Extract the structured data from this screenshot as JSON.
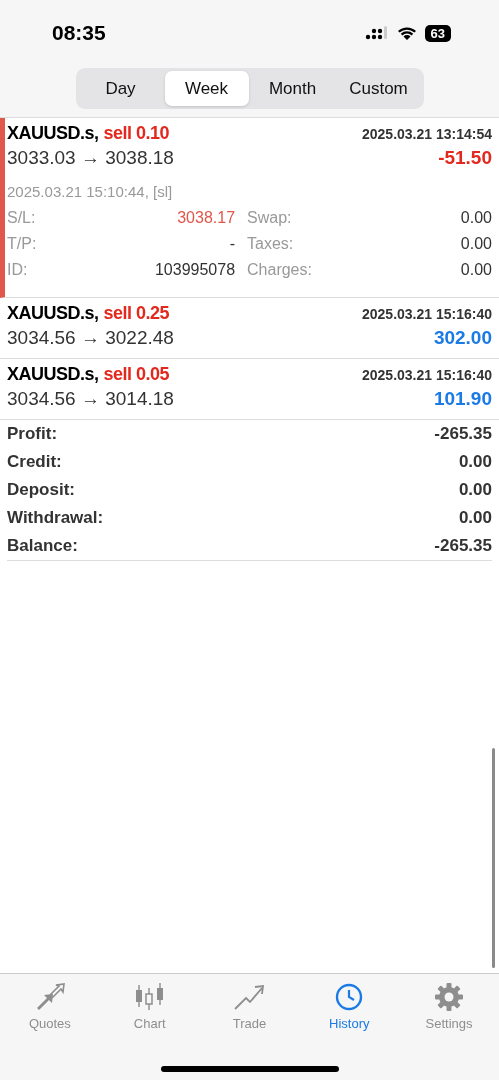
{
  "status_bar": {
    "time": "08:35",
    "battery": "63"
  },
  "periods": [
    {
      "label": "Day",
      "selected": false
    },
    {
      "label": "Week",
      "selected": true
    },
    {
      "label": "Month",
      "selected": false
    },
    {
      "label": "Custom",
      "selected": false
    }
  ],
  "deals": [
    {
      "symbol": "XAUUSD.s,",
      "order": "sell 0.10",
      "time": "2025.03.21 13:14:54",
      "prices": "3033.03 → 3038.18",
      "profit": "-51.50",
      "kind": "loss",
      "selected": true,
      "expanded": true,
      "close_info": "2025.03.21 15:10:44, [sl]",
      "details": [
        {
          "label": "S/L:",
          "value": "3038.17",
          "label2": "Swap:",
          "value2": "0.00",
          "kind": "stop"
        },
        {
          "label": "T/P:",
          "value": "-",
          "label2": "Taxes:",
          "value2": "0.00",
          "kind": "plain"
        },
        {
          "label": "ID:",
          "value": "103995078",
          "label2": "Charges:",
          "value2": "0.00",
          "kind": "plain"
        }
      ]
    },
    {
      "symbol": "XAUUSD.s,",
      "order": "sell 0.25",
      "time": "2025.03.21 15:16:40",
      "prices": "3034.56 → 3022.48",
      "profit": "302.00",
      "kind": "gain",
      "selected": false,
      "expanded": false
    },
    {
      "symbol": "XAUUSD.s,",
      "order": "sell 0.05",
      "time": "2025.03.21 15:16:40",
      "prices": "3034.56 → 3014.18",
      "profit": "101.90",
      "kind": "gain",
      "selected": false,
      "expanded": false
    }
  ],
  "summary": [
    {
      "label": "Profit:",
      "value": "-265.35"
    },
    {
      "label": "Credit:",
      "value": "0.00"
    },
    {
      "label": "Deposit:",
      "value": "0.00"
    },
    {
      "label": "Withdrawal:",
      "value": "0.00"
    },
    {
      "label": "Balance:",
      "value": "-265.35"
    }
  ],
  "tab_bar": [
    {
      "label": "Quotes",
      "kind": "quotes",
      "selected": false
    },
    {
      "label": "Chart",
      "kind": "chart",
      "selected": false
    },
    {
      "label": "Trade",
      "kind": "trade",
      "selected": false
    },
    {
      "label": "History",
      "kind": "history",
      "selected": true
    },
    {
      "label": "Settings",
      "kind": "settings",
      "selected": false
    }
  ]
}
